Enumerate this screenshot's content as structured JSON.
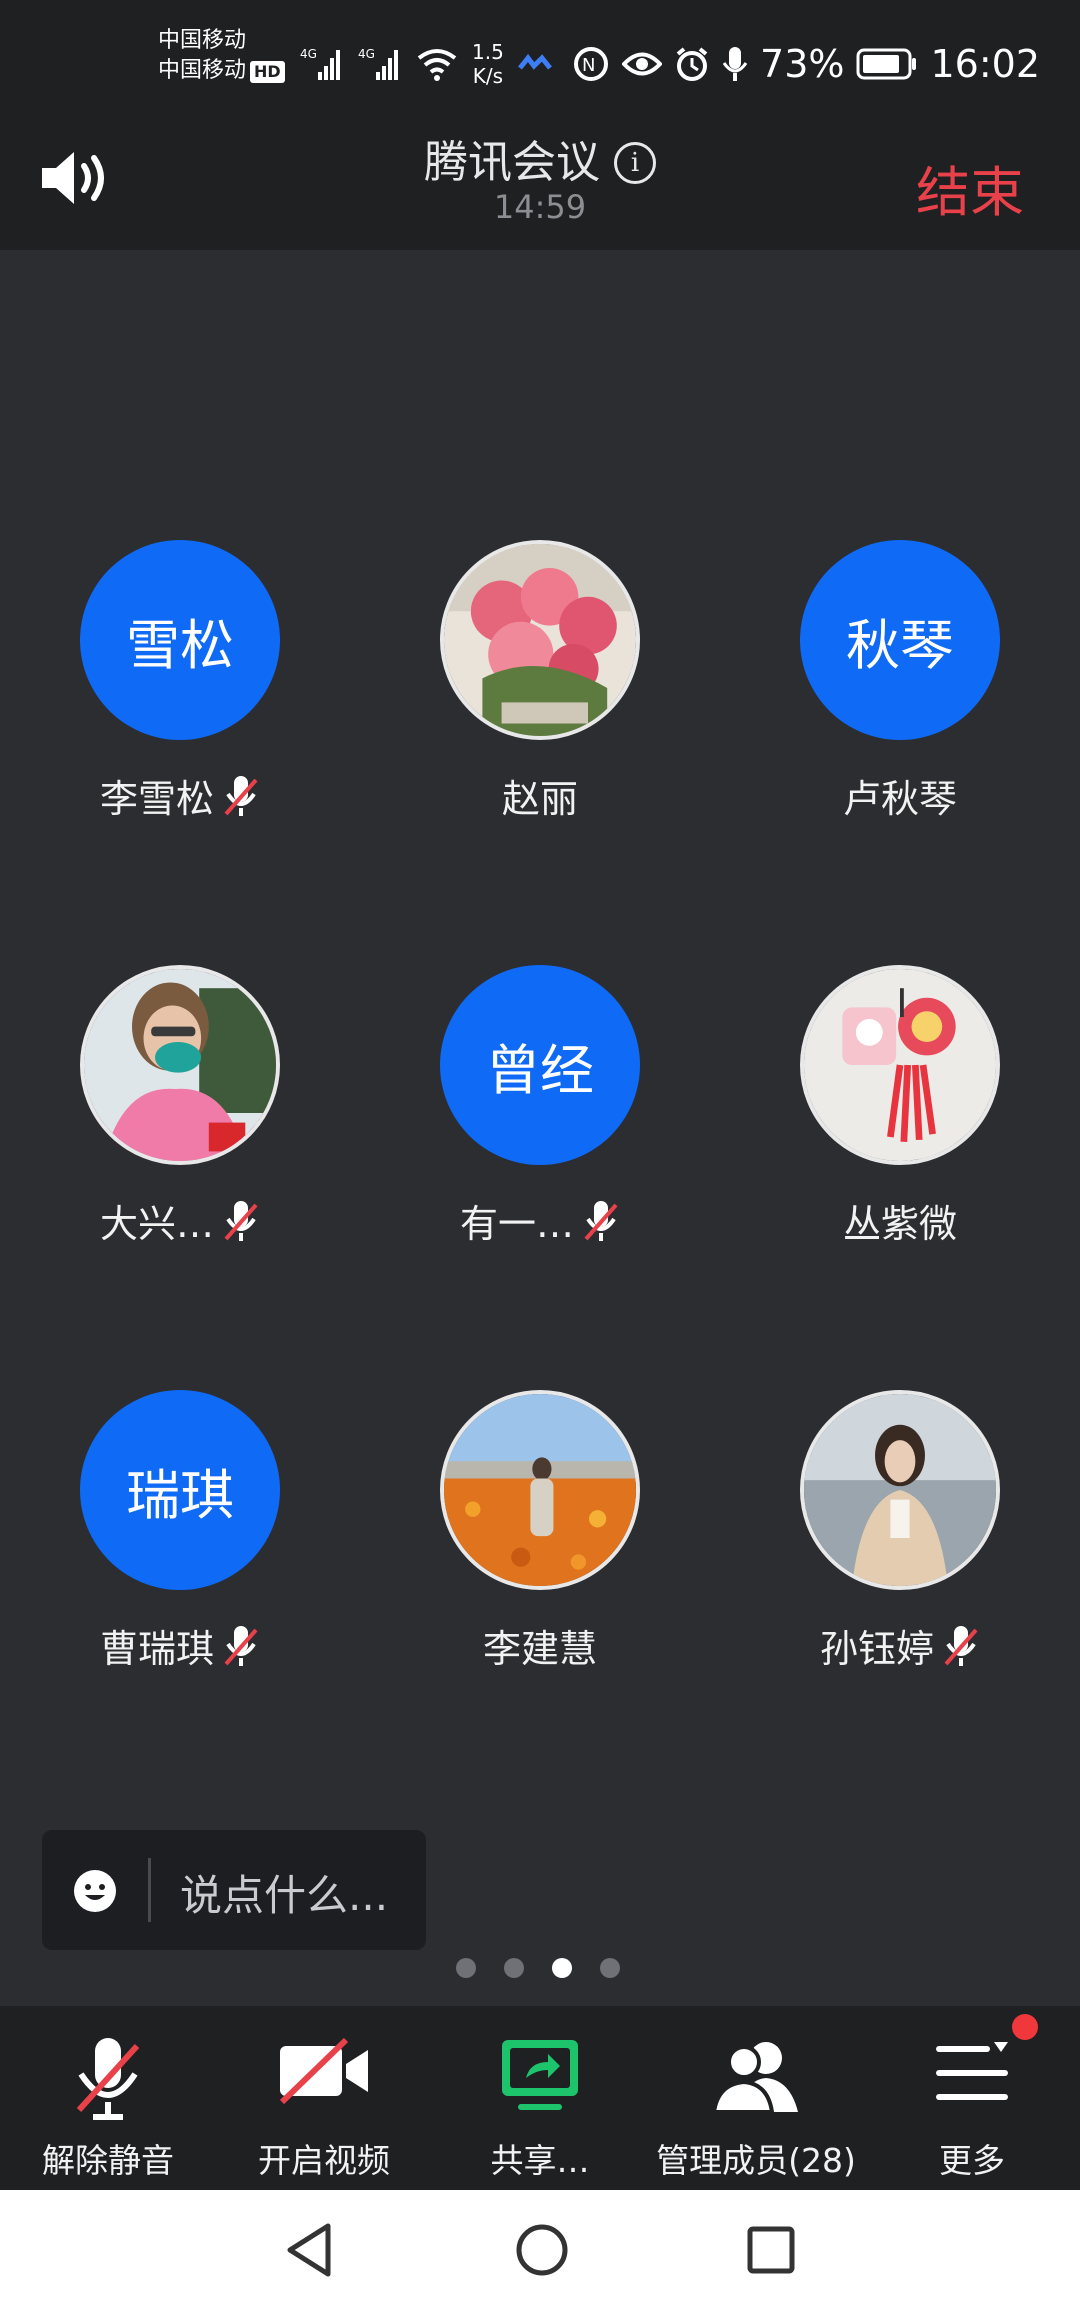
{
  "status_bar": {
    "carrier1": "中国移动",
    "carrier2": "中国移动",
    "hd": "HD",
    "net_speed_value": "1.5",
    "net_speed_unit": "K/s",
    "battery": "73%",
    "time": "16:02"
  },
  "header": {
    "title": "腾讯会议",
    "duration": "14:59",
    "end_label": "结束"
  },
  "participants": [
    {
      "display_name": "李雪松",
      "avatar_text": "雪松",
      "muted": true
    },
    {
      "display_name": "赵丽",
      "avatar_text": "",
      "muted": false
    },
    {
      "display_name": "卢秋琴",
      "avatar_text": "秋琴",
      "muted": false
    },
    {
      "display_name": "大兴…",
      "avatar_text": "",
      "muted": true
    },
    {
      "display_name": "有一…",
      "avatar_text": "曾经",
      "muted": true
    },
    {
      "display_name": "丛紫微",
      "avatar_text": "",
      "muted": false
    },
    {
      "display_name": "曹瑞琪",
      "avatar_text": "瑞琪",
      "muted": true
    },
    {
      "display_name": "李建慧",
      "avatar_text": "",
      "muted": false
    },
    {
      "display_name": "孙钰婷",
      "avatar_text": "",
      "muted": true
    }
  ],
  "chat": {
    "placeholder": "说点什么..."
  },
  "pagination": {
    "total": 4,
    "current": 3
  },
  "toolbar": {
    "unmute": "解除静音",
    "video": "开启视频",
    "share": "共享…",
    "members": "管理成员(28)",
    "more": "更多"
  },
  "colors": {
    "accent_blue": "#0f6af5",
    "end_red": "#e8414a",
    "share_green": "#1dc46c",
    "background": "#2b2d31"
  },
  "icons": {
    "speaker": "speaker-icon",
    "mic_off": "mic-off-icon",
    "video_off": "video-off-icon",
    "share": "share-screen-icon",
    "members": "members-icon",
    "more": "more-menu-icon",
    "emoji": "smiley-icon"
  }
}
